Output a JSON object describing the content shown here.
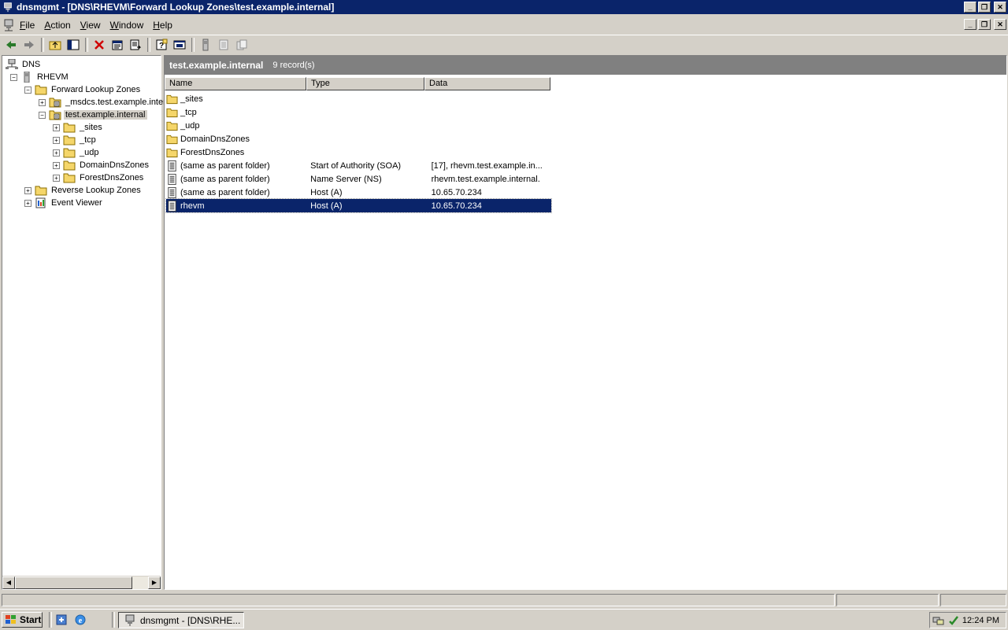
{
  "window": {
    "title": "dnsmgmt - [DNS\\RHEVM\\Forward Lookup Zones\\test.example.internal]"
  },
  "menu": {
    "items": [
      {
        "accel": "F",
        "rest": "ile"
      },
      {
        "accel": "A",
        "rest": "ction"
      },
      {
        "accel": "V",
        "rest": "iew"
      },
      {
        "accel": "W",
        "rest": "indow"
      },
      {
        "accel": "H",
        "rest": "elp"
      }
    ]
  },
  "toolbar": {
    "icons": [
      "back-arrow-icon",
      "forward-arrow-icon",
      "up-folder-icon",
      "show-hide-tree-icon",
      "delete-icon",
      "properties-icon",
      "export-list-icon",
      "help-icon",
      "mmc-window-icon",
      "server-icon",
      "records-icon",
      "zones-icon"
    ]
  },
  "tree": {
    "nodes": [
      {
        "label": "DNS",
        "level": 0,
        "expander": "",
        "icon": "dns-icon"
      },
      {
        "label": "RHEVM",
        "level": 1,
        "expander": "-",
        "icon": "server-icon"
      },
      {
        "label": "Forward Lookup Zones",
        "level": 2,
        "expander": "-",
        "icon": "folder-icon"
      },
      {
        "label": "_msdcs.test.example.internal",
        "level": 3,
        "expander": "+",
        "icon": "zone-icon"
      },
      {
        "label": "test.example.internal",
        "level": 3,
        "expander": "-",
        "icon": "zone-icon",
        "selected": true
      },
      {
        "label": "_sites",
        "level": 4,
        "expander": "+",
        "icon": "folder-icon"
      },
      {
        "label": "_tcp",
        "level": 4,
        "expander": "+",
        "icon": "folder-icon"
      },
      {
        "label": "_udp",
        "level": 4,
        "expander": "+",
        "icon": "folder-icon"
      },
      {
        "label": "DomainDnsZones",
        "level": 4,
        "expander": "+",
        "icon": "folder-icon"
      },
      {
        "label": "ForestDnsZones",
        "level": 4,
        "expander": "+",
        "icon": "folder-icon"
      },
      {
        "label": "Reverse Lookup Zones",
        "level": 2,
        "expander": "+",
        "icon": "folder-icon"
      },
      {
        "label": "Event Viewer",
        "level": 2,
        "expander": "+",
        "icon": "event-viewer-icon"
      }
    ]
  },
  "details": {
    "title": "test.example.internal",
    "count": "9 record(s)",
    "columns": [
      "Name",
      "Type",
      "Data"
    ],
    "rows": [
      {
        "name": "_sites",
        "type": "",
        "data": "",
        "icon": "folder-icon"
      },
      {
        "name": "_tcp",
        "type": "",
        "data": "",
        "icon": "folder-icon"
      },
      {
        "name": "_udp",
        "type": "",
        "data": "",
        "icon": "folder-icon"
      },
      {
        "name": "DomainDnsZones",
        "type": "",
        "data": "",
        "icon": "folder-icon"
      },
      {
        "name": "ForestDnsZones",
        "type": "",
        "data": "",
        "icon": "folder-icon"
      },
      {
        "name": "(same as parent folder)",
        "type": "Start of Authority (SOA)",
        "data": "[17], rhevm.test.example.in...",
        "icon": "record-icon"
      },
      {
        "name": "(same as parent folder)",
        "type": "Name Server (NS)",
        "data": "rhevm.test.example.internal.",
        "icon": "record-icon"
      },
      {
        "name": "(same as parent folder)",
        "type": "Host (A)",
        "data": "10.65.70.234",
        "icon": "record-icon"
      },
      {
        "name": "rhevm",
        "type": "Host (A)",
        "data": "10.65.70.234",
        "icon": "record-icon",
        "selected": true
      }
    ]
  },
  "taskbar": {
    "start_label": "Start",
    "task_label": "dnsmgmt - [DNS\\RHE...",
    "clock": "12:24 PM"
  },
  "colors": {
    "titlebar": "#0a246a",
    "selection": "#0a246a",
    "folder": "#f5d66a",
    "chrome": "#d4d0c8"
  }
}
